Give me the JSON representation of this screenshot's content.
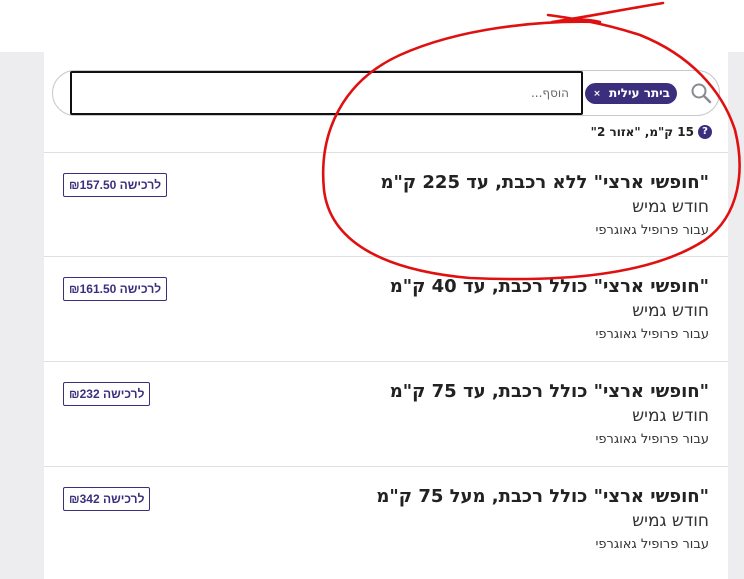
{
  "search": {
    "chip_label": "ביתר עילית",
    "chip_remove": "×",
    "input_placeholder": "הוסף..."
  },
  "zone_info": {
    "help": "?",
    "text": "15 ק\"מ, \"אזור 2\""
  },
  "products": [
    {
      "title": "\"חופשי ארצי\" ללא רכבת, עד 225 ק\"מ",
      "period": "חודש גמיש",
      "profile": "עבור פרופיל גאוגרפי",
      "buy_label": "לרכישה ₪157.50"
    },
    {
      "title": "\"חופשי ארצי\" כולל רכבת, עד 40 ק\"מ",
      "period": "חודש גמיש",
      "profile": "עבור פרופיל גאוגרפי",
      "buy_label": "לרכישה ₪161.50"
    },
    {
      "title": "\"חופשי ארצי\" כולל רכבת, עד 75 ק\"מ",
      "period": "חודש גמיש",
      "profile": "עבור פרופיל גאוגרפי",
      "buy_label": "לרכישה ₪232"
    },
    {
      "title": "\"חופשי ארצי\" כולל רכבת, מעל 75 ק\"מ",
      "period": "חודש גמיש",
      "profile": "עבור פרופיל גאוגרפי",
      "buy_label": "לרכישה ₪342"
    }
  ],
  "colors": {
    "accent": "#3b2f7d",
    "annotation": "#e01010"
  }
}
